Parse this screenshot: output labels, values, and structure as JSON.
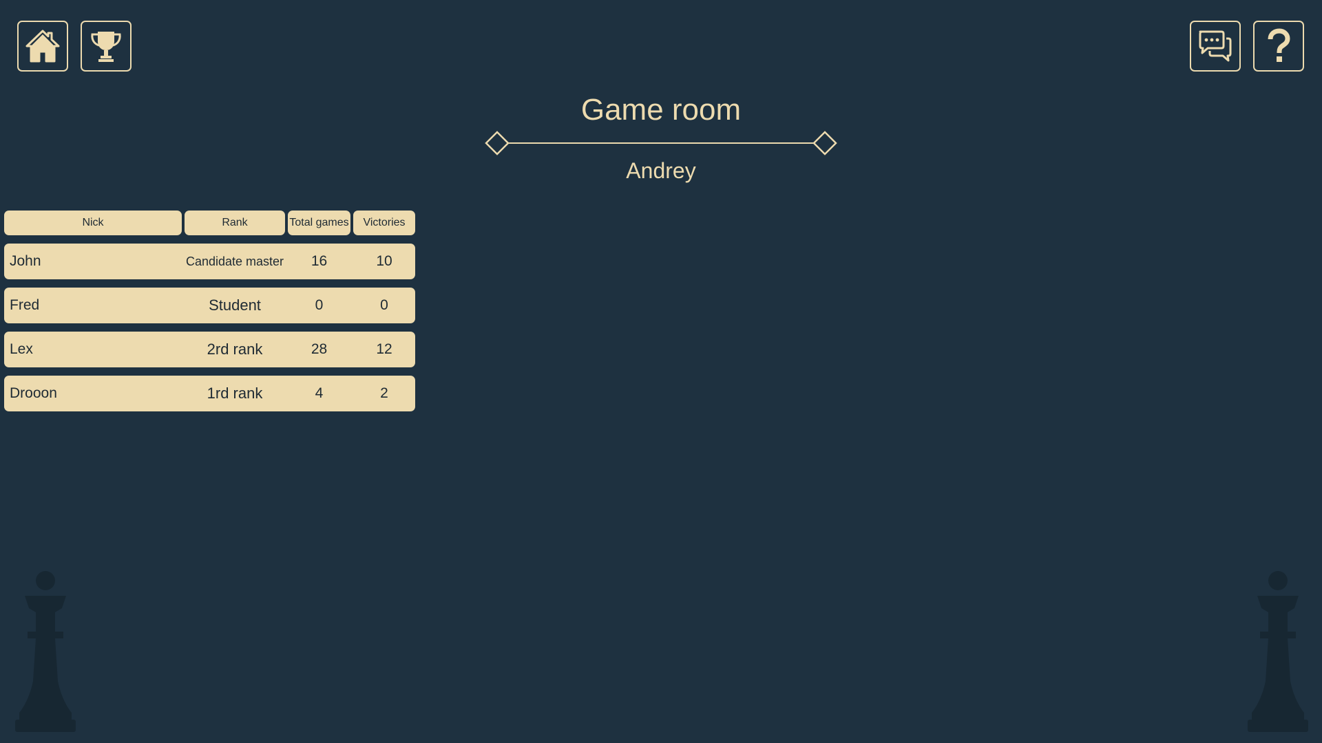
{
  "header": {
    "title": "Game room",
    "player_name": "Andrey"
  },
  "toolbar": {
    "home_icon": "home-icon",
    "trophy_icon": "trophy-icon",
    "chat_icon": "chat-icon",
    "help_icon": "help-icon"
  },
  "table": {
    "columns": {
      "nick": "Nick",
      "rank": "Rank",
      "total_games": "Total games",
      "victories": "Victories"
    },
    "rows": [
      {
        "nick": "John",
        "rank": "Candidate master",
        "total_games": "16",
        "victories": "10"
      },
      {
        "nick": "Fred",
        "rank": "Student",
        "total_games": "0",
        "victories": "0"
      },
      {
        "nick": "Lex",
        "rank": "2rd rank",
        "total_games": "28",
        "victories": "12"
      },
      {
        "nick": "Drooon",
        "rank": "1rd rank",
        "total_games": "4",
        "victories": "2"
      }
    ]
  },
  "colors": {
    "background": "#1e3140",
    "accent": "#eddbaf",
    "text_dark": "#1e2a33",
    "decor_piece": "#172732"
  },
  "decor": {
    "left_piece": "queen-icon",
    "right_piece": "queen-icon"
  }
}
